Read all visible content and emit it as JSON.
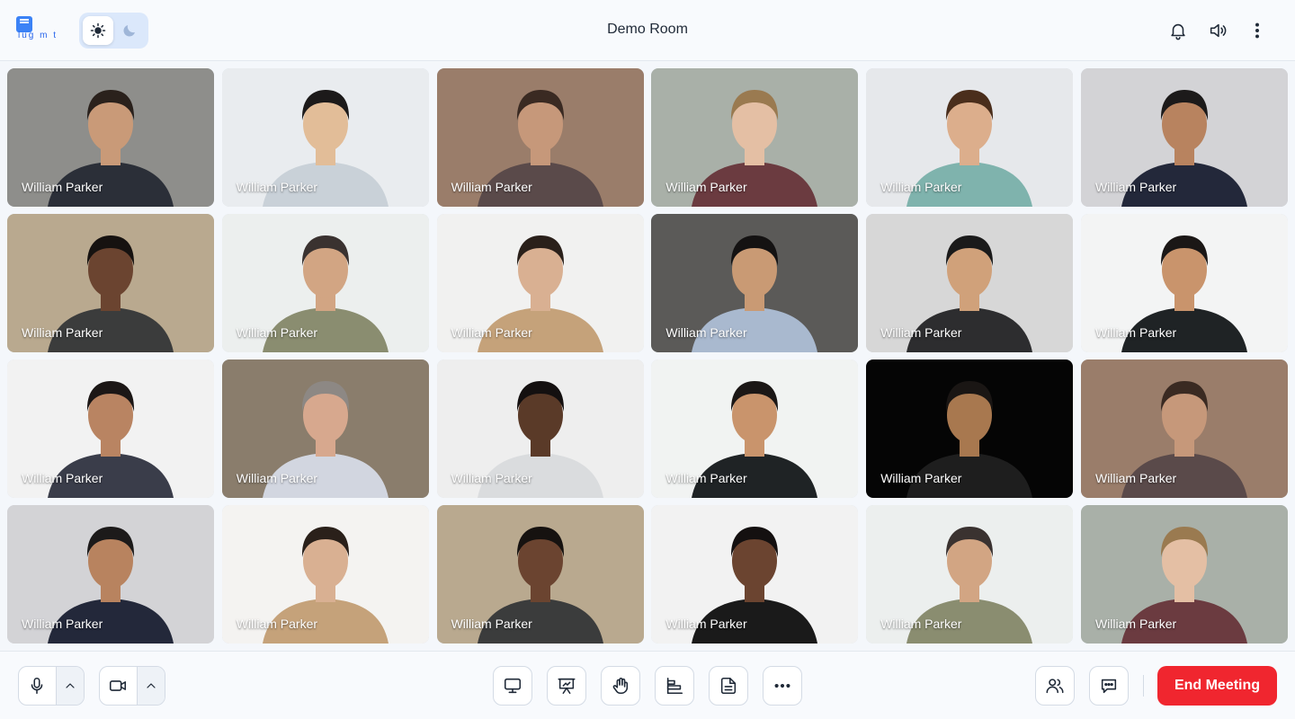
{
  "header": {
    "logo_text": "lug m t",
    "room_title": "Demo Room",
    "icons": [
      "bell-icon",
      "speaker-icon",
      "more-vertical-icon"
    ],
    "theme_toggle": {
      "active": "light",
      "options": [
        "sun-icon",
        "moon-icon"
      ]
    }
  },
  "participants": [
    {
      "name": "William Parker",
      "bg": "#8e8e8b",
      "skin": "#c99a78",
      "shirt": "#2b2f38",
      "hair": "#2a211c"
    },
    {
      "name": "William Parker",
      "bg": "#e9ecef",
      "skin": "#e2bd98",
      "shirt": "#c9d1d8",
      "hair": "#1c1a1a"
    },
    {
      "name": "William Parker",
      "bg": "#9a7d6a",
      "skin": "#c6987a",
      "shirt": "#5a4a4a",
      "hair": "#3a2a22"
    },
    {
      "name": "William Parker",
      "bg": "#a9b0a8",
      "skin": "#e4bfa4",
      "shirt": "#6b3b40",
      "hair": "#9a7a50"
    },
    {
      "name": "William Parker",
      "bg": "#e6e8eb",
      "skin": "#dcae8c",
      "shirt": "#7fb3ad",
      "hair": "#4a2e1c"
    },
    {
      "name": "William Parker",
      "bg": "#d3d3d6",
      "skin": "#b8835f",
      "shirt": "#23283a",
      "hair": "#1c1a1a"
    },
    {
      "name": "William Parker",
      "bg": "#b9a98f",
      "skin": "#6b4430",
      "shirt": "#3b3c3c",
      "hair": "#161210"
    },
    {
      "name": "William Parker",
      "bg": "#ecefee",
      "skin": "#d2a583",
      "shirt": "#8a8d70",
      "hair": "#3a3230"
    },
    {
      "name": "William Parker",
      "bg": "#f1f1f0",
      "skin": "#d9b092",
      "shirt": "#c5a27a",
      "hair": "#2a201a"
    },
    {
      "name": "William Parker",
      "bg": "#5b5a58",
      "skin": "#c99a74",
      "shirt": "#a9b9cf",
      "hair": "#141212"
    },
    {
      "name": "William Parker",
      "bg": "#d7d7d7",
      "skin": "#d0a17a",
      "shirt": "#2d2d2f",
      "hair": "#1a1a1a"
    },
    {
      "name": "William Parker",
      "bg": "#f3f4f4",
      "skin": "#c9946c",
      "shirt": "#1f2325",
      "hair": "#1b1716"
    },
    {
      "name": "William Parker",
      "bg": "#f2f2f2",
      "skin": "#b98462",
      "shirt": "#3a3d4a",
      "hair": "#1c1716"
    },
    {
      "name": "William Parker",
      "bg": "#8a7d6c",
      "skin": "#d7a88e",
      "shirt": "#d2d6e0",
      "hair": "#8d8884"
    },
    {
      "name": "William Parker",
      "bg": "#eeeeee",
      "skin": "#5a3a28",
      "shirt": "#dadcde",
      "hair": "#141010"
    },
    {
      "name": "William Parker",
      "bg": "#f1f3f2",
      "skin": "#c9946c",
      "shirt": "#1f2325",
      "hair": "#1b1716"
    },
    {
      "name": "William Parker",
      "bg": "#050505",
      "skin": "#a8784f",
      "shirt": "#1e1e1e",
      "hair": "#1a1614"
    },
    {
      "name": "William Parker",
      "bg": "#9a7d6a",
      "skin": "#c6987a",
      "shirt": "#5a4a4a",
      "hair": "#3a2a22"
    },
    {
      "name": "William Parker",
      "bg": "#d3d3d6",
      "skin": "#b8835f",
      "shirt": "#23283a",
      "hair": "#1c1a1a"
    },
    {
      "name": "William Parker",
      "bg": "#f4f3f1",
      "skin": "#d9b092",
      "shirt": "#c5a27a",
      "hair": "#2a201a"
    },
    {
      "name": "William Parker",
      "bg": "#b9a98f",
      "skin": "#6b4430",
      "shirt": "#3b3c3c",
      "hair": "#161210"
    },
    {
      "name": "William Parker",
      "bg": "#f2f2f2",
      "skin": "#6b4430",
      "shirt": "#1a1a1a",
      "hair": "#141010"
    },
    {
      "name": "William Parker",
      "bg": "#ecefee",
      "skin": "#d2a583",
      "shirt": "#8a8d70",
      "hair": "#3a3230"
    },
    {
      "name": "William Parker",
      "bg": "#a9b0a8",
      "skin": "#e4bfa4",
      "shirt": "#6b3b40",
      "hair": "#9a7a50"
    }
  ],
  "toolbar": {
    "left": [
      "microphone-icon",
      "chevron-up-icon",
      "camera-icon",
      "chevron-up-icon"
    ],
    "center": [
      "screen-share-icon",
      "presentation-icon",
      "raise-hand-icon",
      "poll-icon",
      "notes-icon",
      "more-horizontal-icon"
    ],
    "right": [
      "participants-icon",
      "chat-icon"
    ],
    "end_meeting_label": "End Meeting",
    "end_meeting_color": "#f0262f"
  }
}
